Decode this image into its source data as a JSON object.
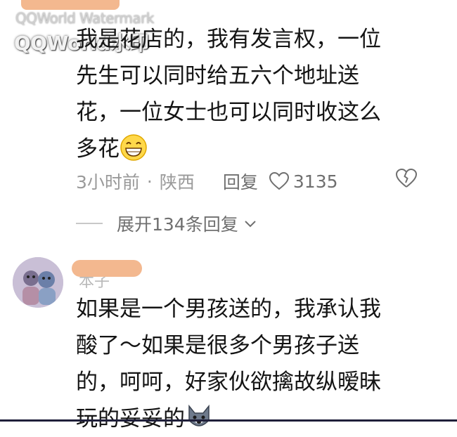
{
  "watermark": {
    "line1": "QQWorld Watermark",
    "line2": "QQWorld水印"
  },
  "comment1": {
    "lines": [
      "我是花店的，我有发言权，一位",
      "先生可以同时给五六个地址送",
      "花，一位女士也可以同时收这么",
      "多花"
    ],
    "emoji": "grinning-face-icon",
    "time": "3小时前",
    "separator": "·",
    "location": "陕西",
    "reply_label": "回复",
    "like_count": "3135"
  },
  "expand_replies": {
    "label": "展开134条回复"
  },
  "comment2": {
    "username_partial": "本子",
    "lines": [
      "如果是一个男孩送的，我承认我",
      "酸了～如果是很多个男孩子送",
      "的，呵呵，好家伙欲擒故纵暧昧",
      "玩的妥妥的"
    ],
    "emoji": "wolf-face-icon"
  },
  "colors": {
    "primary_text": "#141414",
    "meta_text": "#9a9a9a",
    "redaction": "#f3b88f"
  }
}
